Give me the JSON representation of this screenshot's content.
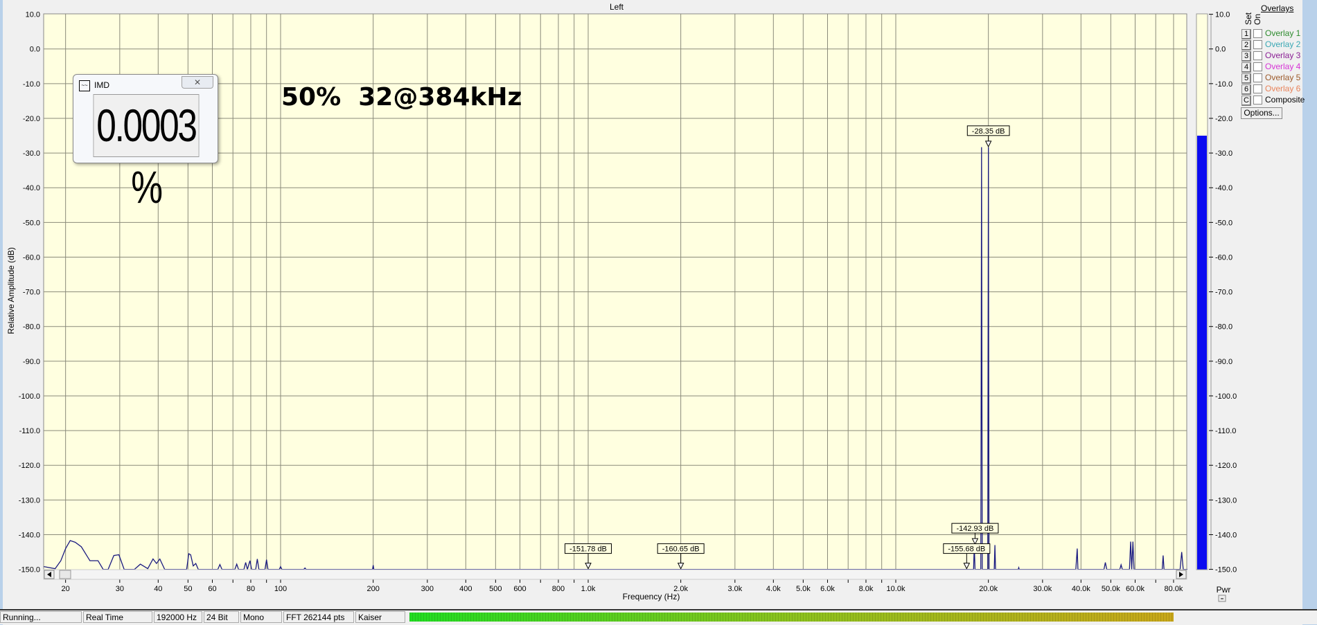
{
  "window_title": "Left",
  "annotation": "50%  32@384kHz",
  "imd_window": {
    "title": "IMD",
    "value": "0.0003 %",
    "icon": "waveform-icon",
    "close_icon": "close-icon"
  },
  "chart_data": {
    "type": "line",
    "title": "Left",
    "xlabel": "Frequency (Hz)",
    "ylabel": "Relative Amplitude (dB)",
    "xscale": "log",
    "xlim": [
      17,
      88700
    ],
    "ylim": [
      -150,
      10
    ],
    "grid": true,
    "y_ticks": [
      "10.0",
      "0.0",
      "-10.0",
      "-20.0",
      "-30.0",
      "-40.0",
      "-50.0",
      "-60.0",
      "-70.0",
      "-80.0",
      "-90.0",
      "-100.0",
      "-110.0",
      "-120.0",
      "-130.0",
      "-140.0",
      "-150.0"
    ],
    "y_tick_values": [
      10,
      0,
      -10,
      -20,
      -30,
      -40,
      -50,
      -60,
      -70,
      -80,
      -90,
      -100,
      -110,
      -120,
      -130,
      -140,
      -150
    ],
    "x_ticks": [
      {
        "v": 20,
        "l": "20"
      },
      {
        "v": 30,
        "l": "30"
      },
      {
        "v": 40,
        "l": "40"
      },
      {
        "v": 50,
        "l": "50"
      },
      {
        "v": 60,
        "l": "60"
      },
      {
        "v": 80,
        "l": "80"
      },
      {
        "v": 100,
        "l": "100"
      },
      {
        "v": 200,
        "l": "200"
      },
      {
        "v": 300,
        "l": "300"
      },
      {
        "v": 400,
        "l": "400"
      },
      {
        "v": 500,
        "l": "500"
      },
      {
        "v": 600,
        "l": "600"
      },
      {
        "v": 800,
        "l": "800"
      },
      {
        "v": 1000,
        "l": "1.0k"
      },
      {
        "v": 2000,
        "l": "2.0k"
      },
      {
        "v": 3000,
        "l": "3.0k"
      },
      {
        "v": 4000,
        "l": "4.0k"
      },
      {
        "v": 5000,
        "l": "5.0k"
      },
      {
        "v": 6000,
        "l": "6.0k"
      },
      {
        "v": 8000,
        "l": "8.0k"
      },
      {
        "v": 10000,
        "l": "10.0k"
      },
      {
        "v": 20000,
        "l": "20.0k"
      },
      {
        "v": 30000,
        "l": "30.0k"
      },
      {
        "v": 40000,
        "l": "40.0k"
      },
      {
        "v": 50000,
        "l": "50.0k"
      },
      {
        "v": 60000,
        "l": "60.0k"
      },
      {
        "v": 80000,
        "l": "80.0k"
      }
    ],
    "x_gridlines": [
      20,
      30,
      40,
      50,
      60,
      70,
      80,
      90,
      100,
      200,
      300,
      400,
      500,
      600,
      700,
      800,
      900,
      1000,
      2000,
      3000,
      4000,
      5000,
      6000,
      7000,
      8000,
      9000,
      10000,
      20000,
      30000,
      40000,
      50000,
      60000,
      70000,
      80000
    ],
    "series": [
      {
        "name": "Left",
        "color": "#1a1a80",
        "points": [
          [
            17,
            -149.2
          ],
          [
            18.5,
            -149.8
          ],
          [
            19.3,
            -147.5
          ],
          [
            20,
            -144
          ],
          [
            20.7,
            -141.7
          ],
          [
            21.5,
            -142.2
          ],
          [
            22.5,
            -143.5
          ],
          [
            24,
            -147.5
          ],
          [
            25.5,
            -147.5
          ],
          [
            26.5,
            -150
          ],
          [
            27.5,
            -150
          ],
          [
            28.7,
            -146
          ],
          [
            29.8,
            -145.8
          ],
          [
            31,
            -150
          ],
          [
            33.5,
            -150
          ],
          [
            35,
            -148.5
          ],
          [
            37,
            -149.8
          ],
          [
            38.5,
            -147
          ],
          [
            39.5,
            -148.3
          ],
          [
            40.5,
            -147
          ],
          [
            42,
            -150
          ],
          [
            49.5,
            -150
          ],
          [
            50.3,
            -145.5
          ],
          [
            51,
            -145.8
          ],
          [
            52,
            -149
          ],
          [
            53,
            -148.3
          ],
          [
            54,
            -150
          ],
          [
            62.5,
            -150
          ],
          [
            63.5,
            -148.6
          ],
          [
            64.5,
            -150
          ],
          [
            71,
            -150
          ],
          [
            72,
            -148.5
          ],
          [
            73,
            -150
          ],
          [
            76,
            -150
          ],
          [
            77,
            -148
          ],
          [
            78,
            -150
          ],
          [
            79.5,
            -147.5
          ],
          [
            80.5,
            -150
          ],
          [
            83,
            -150
          ],
          [
            84,
            -147
          ],
          [
            85,
            -150
          ],
          [
            89,
            -150
          ],
          [
            90,
            -147.2
          ],
          [
            91,
            -150
          ],
          [
            99,
            -150
          ],
          [
            100,
            -149.2
          ],
          [
            101,
            -150
          ],
          [
            119,
            -150
          ],
          [
            120,
            -149.6
          ],
          [
            121,
            -150
          ],
          [
            199,
            -150
          ],
          [
            200,
            -148.8
          ],
          [
            201,
            -150
          ],
          [
            17900,
            -150
          ],
          [
            18000,
            -143
          ],
          [
            18100,
            -150
          ],
          [
            18900,
            -150
          ],
          [
            18950,
            -89
          ],
          [
            19000,
            -28.3
          ],
          [
            19050,
            -89
          ],
          [
            19100,
            -150
          ],
          [
            19900,
            -150
          ],
          [
            19950,
            -89
          ],
          [
            20000,
            -28.35
          ],
          [
            20050,
            -85
          ],
          [
            20100,
            -150
          ],
          [
            20900,
            -150
          ],
          [
            21000,
            -143
          ],
          [
            21100,
            -150
          ],
          [
            25000,
            -150
          ],
          [
            25100,
            -149.5
          ],
          [
            25200,
            -150
          ],
          [
            38500,
            -150
          ],
          [
            38900,
            -144
          ],
          [
            39100,
            -150
          ],
          [
            47500,
            -150
          ],
          [
            48000,
            -148
          ],
          [
            48500,
            -150
          ],
          [
            53500,
            -150
          ],
          [
            54000,
            -148.7
          ],
          [
            54500,
            -150
          ],
          [
            57500,
            -150
          ],
          [
            58000,
            -142
          ],
          [
            58500,
            -150
          ],
          [
            59000,
            -142
          ],
          [
            59500,
            -150
          ],
          [
            73500,
            -150
          ],
          [
            74000,
            -146
          ],
          [
            74500,
            -150
          ],
          [
            84000,
            -150
          ],
          [
            85000,
            -145
          ],
          [
            86000,
            -150
          ],
          [
            88700,
            -150
          ]
        ]
      }
    ],
    "markers": [
      {
        "f": 20000,
        "db": -28.35,
        "label": "-28.35 dB"
      },
      {
        "f": 1000,
        "db": -151.78,
        "label": "-151.78 dB"
      },
      {
        "f": 2000,
        "db": -160.65,
        "label": "-160.65 dB"
      },
      {
        "f": 18100,
        "db": -142.93,
        "label": "-142.93 dB"
      },
      {
        "f": 17000,
        "db": -155.68,
        "label": "-155.68 dB"
      }
    ],
    "level_meter": {
      "label": "Pwr",
      "value_db": -25,
      "color": "#0a0af0"
    }
  },
  "overlays": {
    "header": "Overlays",
    "set_label": "Set",
    "on_label": "On",
    "items": [
      {
        "key": "1",
        "label": "Overlay 1",
        "color": "#2e8b2e"
      },
      {
        "key": "2",
        "label": "Overlay 2",
        "color": "#3aa8b4"
      },
      {
        "key": "3",
        "label": "Overlay 3",
        "color": "#8a1f94"
      },
      {
        "key": "4",
        "label": "Overlay 4",
        "color": "#d633d6"
      },
      {
        "key": "5",
        "label": "Overlay 5",
        "color": "#9c5a2a"
      },
      {
        "key": "6",
        "label": "Overlay 6",
        "color": "#e8835a"
      },
      {
        "key": "C",
        "label": "Composite",
        "color": "#000000"
      }
    ],
    "options_label": "Options..."
  },
  "status_bar": {
    "state": "Running...",
    "mode": "Real Time",
    "sample_rate": "192000 Hz",
    "bits": "24 Bit",
    "channels": "Mono",
    "fft": "FFT 262144 pts",
    "window": "Kaiser"
  }
}
